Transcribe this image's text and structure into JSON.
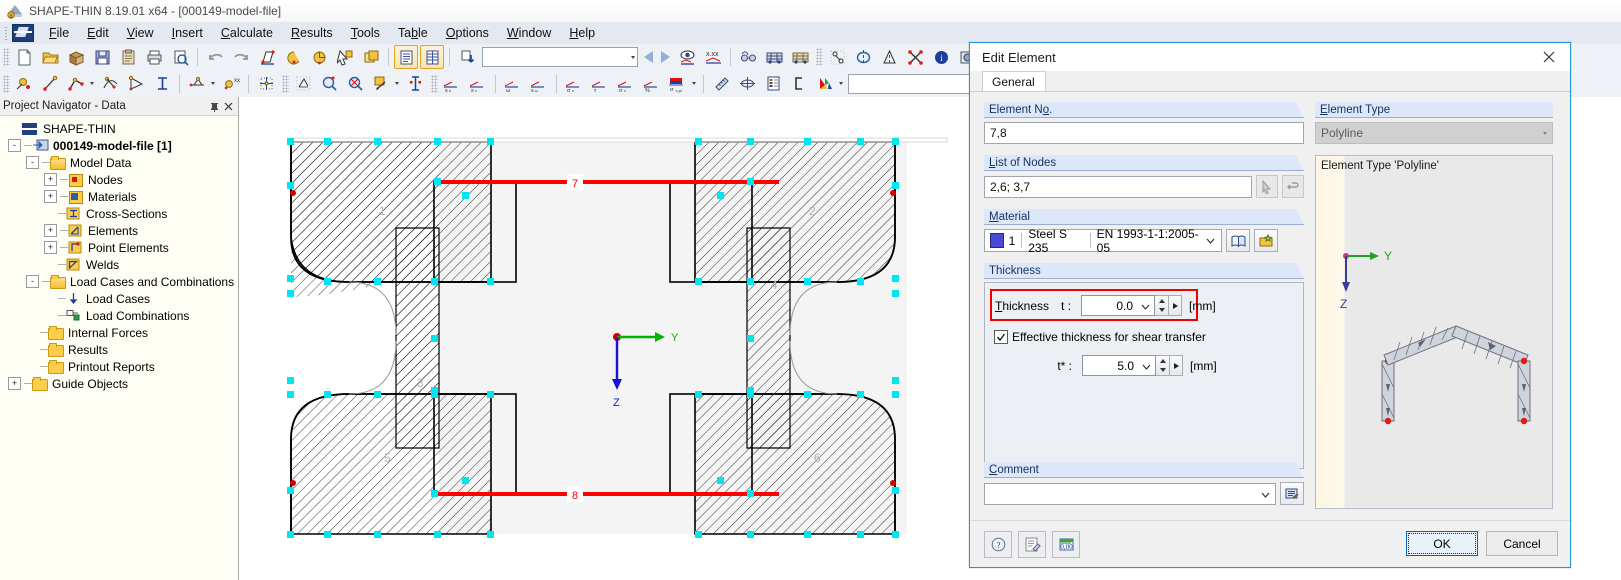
{
  "window": {
    "title": "SHAPE-THIN 8.19.01 x64 - [000149-model-file]",
    "app_icon": "shape-thin-logo-icon"
  },
  "menu": {
    "items": [
      {
        "label": "File",
        "accel": "F"
      },
      {
        "label": "Edit",
        "accel": "E"
      },
      {
        "label": "View",
        "accel": "V"
      },
      {
        "label": "Insert",
        "accel": "I"
      },
      {
        "label": "Calculate",
        "accel": "C"
      },
      {
        "label": "Results",
        "accel": "R"
      },
      {
        "label": "Tools",
        "accel": "T"
      },
      {
        "label": "Table",
        "accel": "b"
      },
      {
        "label": "Options",
        "accel": "O"
      },
      {
        "label": "Window",
        "accel": "W"
      },
      {
        "label": "Help",
        "accel": "H"
      }
    ]
  },
  "toolbar_row1": {
    "icons": [
      "new-file-icon",
      "open-folder-icon",
      "open-package-icon",
      "save-icon",
      "clipboard-icon",
      "print-icon",
      "print-preview-icon",
      "undo-icon",
      "redo-icon",
      "edit-section-icon",
      "rotate-left-icon",
      "rotate-right-icon",
      "select-pointer-icon",
      "copy-window-icon",
      "table-list-icon",
      "table-grid-icon",
      "import-download-icon"
    ],
    "combo_value": "",
    "icons2": [
      "view-eye-icon",
      "x-xx-icon",
      "glasses-icon",
      "render-frame-icon",
      "render-frame2-icon"
    ],
    "icons3": [
      "node-connect-icon",
      "mirror-circle-icon",
      "mirror-axis-icon",
      "cross-snap-icon",
      "info-icon",
      "camera-icon",
      "gears-icon"
    ]
  },
  "toolbar_row2": {
    "icons": [
      "point-add-icon",
      "line-add-icon",
      "polyline-add-icon",
      "arc-add-icon",
      "arc2-add-icon",
      "section-i-icon",
      "stiffener-icon",
      "xx-stress-icon",
      "grid-point-icon",
      "mesh-icon",
      "zoom-in-icon",
      "zoom-out-icon",
      "fill-icon",
      "text-cursor-icon"
    ],
    "stress_icons": [
      "Su",
      "Sv",
      "ω",
      "Sω",
      "σx",
      "τ",
      "σv",
      "%",
      "σx,pl"
    ],
    "tail_icons": [
      "ruler-icon",
      "target-icon",
      "legend-icon",
      "bracket-icon",
      "color-palette-icon"
    ],
    "combo_value": ""
  },
  "navigator": {
    "title": "Project Navigator - Data",
    "pin_icon": "pin-icon",
    "close_icon": "close-icon",
    "root": "SHAPE-THIN",
    "items": [
      {
        "label": "000149-model-file [1]",
        "depth": 1,
        "toggle": "-",
        "icon": "model-file-icon",
        "bold": true
      },
      {
        "label": "Model Data",
        "depth": 2,
        "toggle": "-",
        "icon": "folder-open-icon",
        "bold": false
      },
      {
        "label": "Nodes",
        "depth": 3,
        "toggle": "+",
        "icon": "nodes-icon",
        "bold": false
      },
      {
        "label": "Materials",
        "depth": 3,
        "toggle": "+",
        "icon": "materials-icon",
        "bold": false
      },
      {
        "label": "Cross-Sections",
        "depth": 3,
        "toggle": "",
        "icon": "cross-sections-icon",
        "bold": false
      },
      {
        "label": "Elements",
        "depth": 3,
        "toggle": "+",
        "icon": "elements-icon",
        "bold": false
      },
      {
        "label": "Point Elements",
        "depth": 3,
        "toggle": "+",
        "icon": "point-elements-icon",
        "bold": false
      },
      {
        "label": "Welds",
        "depth": 3,
        "toggle": "",
        "icon": "welds-icon",
        "bold": false
      },
      {
        "label": "Load Cases and Combinations",
        "depth": 2,
        "toggle": "-",
        "icon": "folder-open-icon",
        "bold": false
      },
      {
        "label": "Load Cases",
        "depth": 3,
        "toggle": "",
        "icon": "load-cases-icon",
        "bold": false
      },
      {
        "label": "Load Combinations",
        "depth": 3,
        "toggle": "",
        "icon": "load-combinations-icon",
        "bold": false
      },
      {
        "label": "Internal Forces",
        "depth": 2,
        "toggle": "",
        "icon": "folder-icon",
        "bold": false
      },
      {
        "label": "Results",
        "depth": 2,
        "toggle": "",
        "icon": "folder-icon",
        "bold": false
      },
      {
        "label": "Printout Reports",
        "depth": 2,
        "toggle": "",
        "icon": "folder-icon",
        "bold": false
      },
      {
        "label": "Guide Objects",
        "depth": 2,
        "toggle": "+",
        "icon": "folder-icon",
        "bold": false
      }
    ]
  },
  "canvas": {
    "element_labels": [
      "1",
      "2",
      "3",
      "4",
      "5",
      "6"
    ],
    "node_labels": [
      "7",
      "8"
    ],
    "axis_y": "Y",
    "axis_z": "Z",
    "highlight_color": "#ff0000",
    "selection_color": "#00e5f0"
  },
  "dialog": {
    "title": "Edit Element",
    "close_icon": "close-icon",
    "tab": "General",
    "element_no": {
      "label": "Element No.",
      "accel": "N",
      "value": "7,8"
    },
    "element_type": {
      "label": "Element Type",
      "accel": "E",
      "value": "Polyline"
    },
    "list_of_nodes": {
      "label": "List of Nodes",
      "accel": "L",
      "value": "2,6; 3,7",
      "btn1_icon": "pick-pointer-icon",
      "btn2_icon": "node-list-icon"
    },
    "material": {
      "label": "Material",
      "accel": "M",
      "number": "1",
      "name": "Steel S 235",
      "standard": "EN 1993-1-1:2005-05",
      "color": "#4a4ad6",
      "btn1_icon": "material-library-icon",
      "btn2_icon": "new-material-icon"
    },
    "thickness": {
      "group_label": "Thickness",
      "t_label": "Thickness",
      "t_symbol": "t :",
      "t_value": "0.0",
      "t_unit": "[mm]",
      "highlight_color": "#f20000",
      "checkbox_label": "Effective thickness for shear transfer",
      "checkbox_checked": true,
      "ts_symbol": "t* :",
      "ts_value": "5.0",
      "ts_unit": "[mm]"
    },
    "comment": {
      "label": "Comment",
      "accel": "C",
      "value": "",
      "btn_icon": "comment-library-icon"
    },
    "preview": {
      "caption": "Element Type 'Polyline'",
      "axis_y": "Y",
      "axis_z": "Z"
    },
    "footer": {
      "icons": [
        "help-icon",
        "edit-note-icon",
        "units-icon"
      ],
      "ok": "OK",
      "cancel": "Cancel"
    }
  }
}
